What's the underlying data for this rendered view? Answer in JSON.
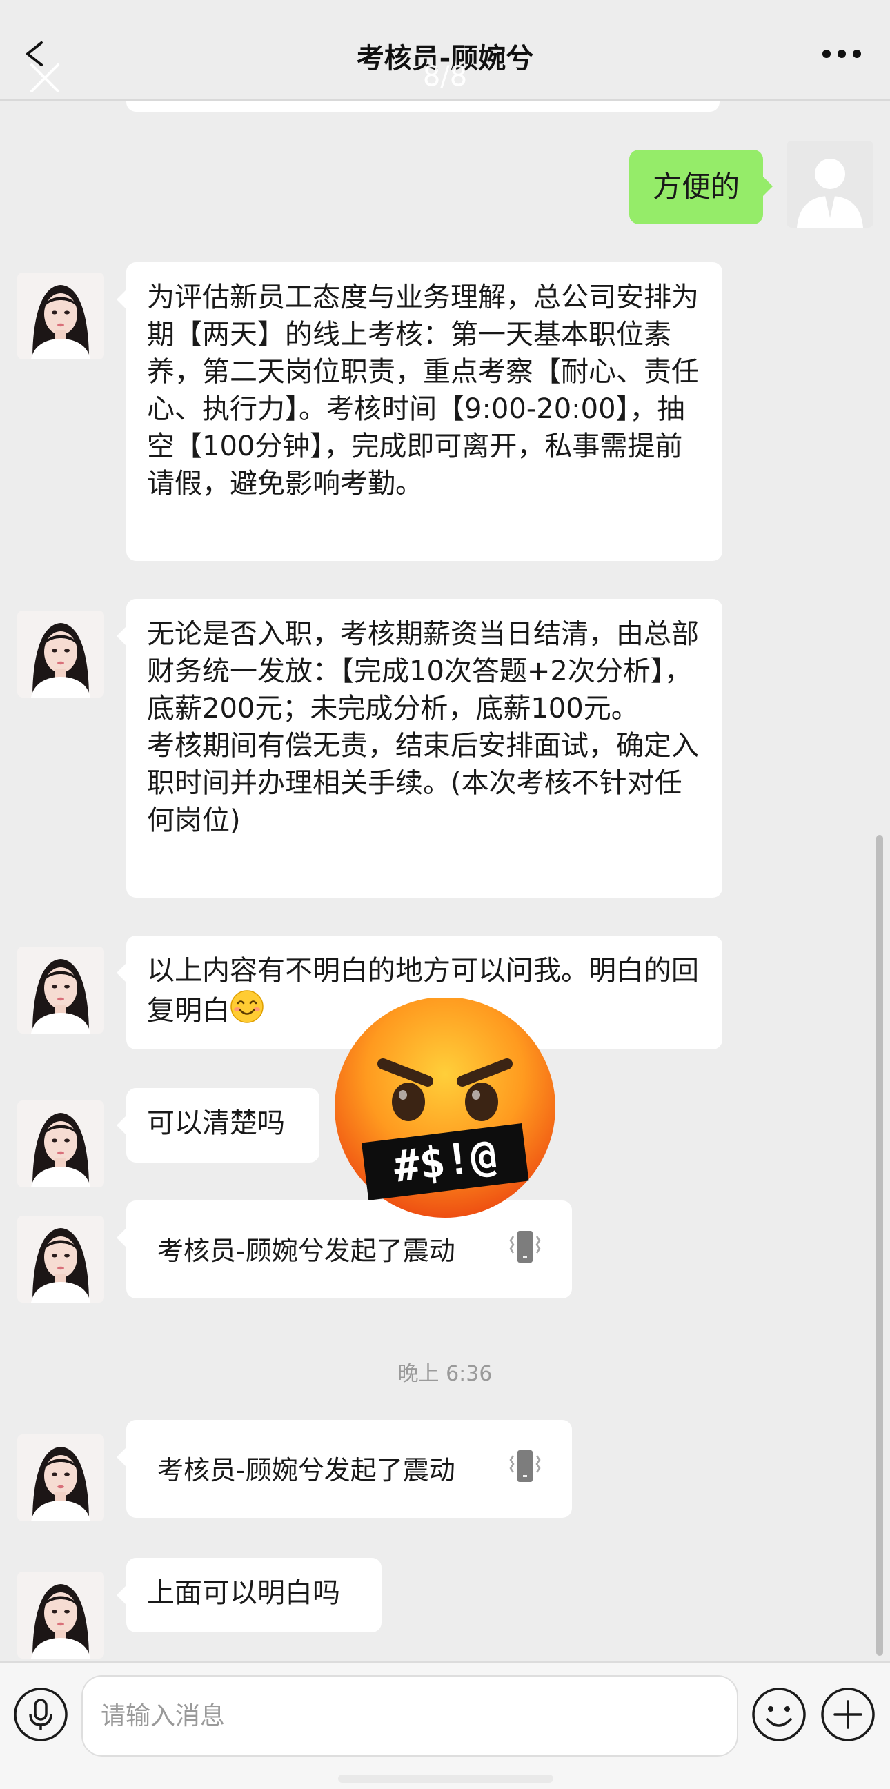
{
  "header": {
    "title": "考核员-顾婉兮",
    "page_indicator": "8/8"
  },
  "messages": [
    {
      "sender": "me",
      "text": "方便的"
    },
    {
      "sender": "other",
      "text": "为评估新员工态度与业务理解，总公司安排为期【两天】的线上考核：第一天基本职位素养，第二天岗位职责，重点考察【耐心、责任心、执行力】。考核时间【9:00-20:00】，抽空【100分钟】，完成即可离开，私事需提前请假，避免影响考勤。"
    },
    {
      "sender": "other",
      "text": "无论是否入职，考核期薪资当日结清，由总部财务统一发放：【完成10次答题+2次分析】，底薪200元；未完成分析，底薪100元。\n考核期间有偿无责，结束后安排面试，确定入职时间并办理相关手续。(本次考核不针对任何岗位)"
    },
    {
      "sender": "other",
      "text": "以上内容有不明白的地方可以问我。明白的回复明白",
      "emoji": "smiling-face"
    },
    {
      "sender": "other",
      "text": "可以清楚吗"
    },
    {
      "sender": "other",
      "type": "vibration",
      "text": "考核员-顾婉兮发起了震动"
    },
    {
      "sender": "other",
      "type": "vibration",
      "text": "考核员-顾婉兮发起了震动"
    },
    {
      "sender": "other",
      "text": "上面可以明白吗"
    }
  ],
  "timestamp": "晚上 6:36",
  "sticker": {
    "name": "cursing-face",
    "text": "#$!@"
  },
  "input": {
    "placeholder": "请输入消息"
  },
  "icons": {
    "back": "chevron-left-icon",
    "close": "close-icon",
    "more": "more-icon",
    "voice": "microphone-icon",
    "emoji": "smiley-icon",
    "plus": "plus-icon",
    "vibration": "phone-vibrate-icon"
  },
  "colors": {
    "background": "#ededed",
    "my_bubble": "#95ec69",
    "other_bubble": "#ffffff"
  }
}
